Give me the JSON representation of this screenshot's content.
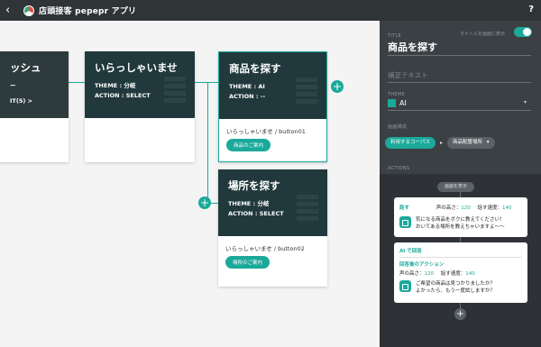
{
  "topbar": {
    "back_icon": "‹",
    "title": "店頭接客 pepepr アプリ",
    "help": "?"
  },
  "canvas": {
    "cards": [
      {
        "title": "ッシュ",
        "line1": "ー",
        "line2": "IT(5) >"
      },
      {
        "title": "いらっしゃいませ",
        "theme": "THEME : 分岐",
        "action": "ACTION : SELECT"
      },
      {
        "title": "商品を探す",
        "theme": "THEME : AI",
        "action": "ACTION : --",
        "button_label": "いらっしゃいませ / button01",
        "button": "商品のご案内"
      },
      {
        "title": "場所を探す",
        "theme": "THEME : 分岐",
        "action": "ACTION : SELECT",
        "button_label": "いらっしゃいませ / button02",
        "button": "場所のご案内"
      }
    ],
    "plus": "+"
  },
  "panel": {
    "title_label": "TITLE",
    "title_display_label": "タイトルを画面に表示",
    "title_value": "商品を探す",
    "subtext_placeholder": "補足テキスト",
    "theme_label": "THEME",
    "theme_value": "AI",
    "theme_caret": "▾",
    "screen_label": "画面構成",
    "chip_course": "利用するコーパス",
    "chip_arrow": "▸",
    "chip_location": "商品配置場所",
    "chip_location_caret": "▾",
    "actions_label": "ACTIONS",
    "display_chip": "画面を表示",
    "action1": {
      "header": "話す",
      "voice_label": "声の高さ：",
      "voice_value": "120",
      "speed_label": "話す速度：",
      "speed_value": "140",
      "text1": "気になる商品をボクに教えてください！",
      "text2": "おいてある場所を教えちゃいますよ〜〜"
    },
    "action2": {
      "header": "AI で回答",
      "sub_header": "回答後のアクション",
      "voice_label": "声の高さ：",
      "voice_value": "120",
      "speed_label": "話す速度：",
      "speed_value": "140",
      "text1": "ご希望の商品は見つかりましたか？",
      "text2": "よかったら、もう一度試しますか？"
    },
    "add": "+"
  },
  "colors": {
    "accent": "#1ba99a",
    "card_head": "#21393c",
    "panel_bg": "#3b4044",
    "topbar_bg": "#2f3437"
  }
}
